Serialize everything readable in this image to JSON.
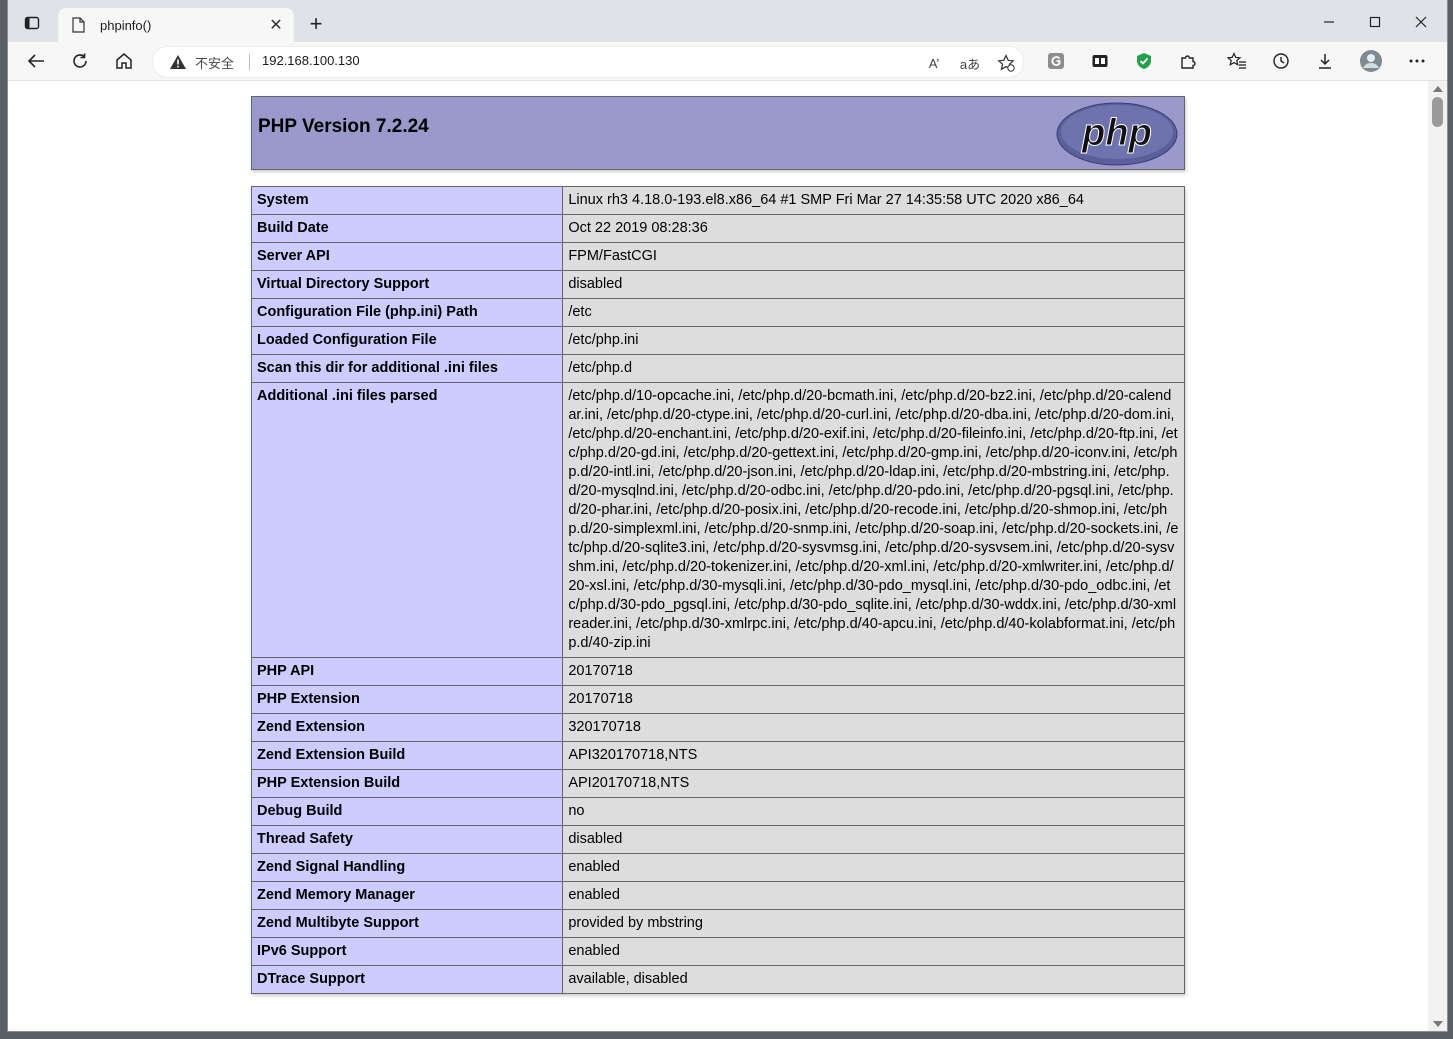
{
  "browser": {
    "tab_title": "phpinfo()",
    "address": {
      "security_label": "不安全",
      "url": "192.168.100.130",
      "read_aloud_label": "A’",
      "translate_label": "aあ"
    }
  },
  "php": {
    "header_title": "PHP Version 7.2.24",
    "logo_text": "php"
  },
  "info_rows": [
    {
      "key": "System",
      "value": "Linux rh3 4.18.0-193.el8.x86_64 #1 SMP Fri Mar 27 14:35:58 UTC 2020 x86_64"
    },
    {
      "key": "Build Date",
      "value": "Oct 22 2019 08:28:36"
    },
    {
      "key": "Server API",
      "value": "FPM/FastCGI"
    },
    {
      "key": "Virtual Directory Support",
      "value": "disabled"
    },
    {
      "key": "Configuration File (php.ini) Path",
      "value": "/etc"
    },
    {
      "key": "Loaded Configuration File",
      "value": "/etc/php.ini"
    },
    {
      "key": "Scan this dir for additional .ini files",
      "value": "/etc/php.d"
    },
    {
      "key": "Additional .ini files parsed",
      "value": "/etc/php.d/10-opcache.ini, /etc/php.d/20-bcmath.ini, /etc/php.d/20-bz2.ini, /etc/php.d/20-calendar.ini, /etc/php.d/20-ctype.ini, /etc/php.d/20-curl.ini, /etc/php.d/20-dba.ini, /etc/php.d/20-dom.ini, /etc/php.d/20-enchant.ini, /etc/php.d/20-exif.ini, /etc/php.d/20-fileinfo.ini, /etc/php.d/20-ftp.ini, /etc/php.d/20-gd.ini, /etc/php.d/20-gettext.ini, /etc/php.d/20-gmp.ini, /etc/php.d/20-iconv.ini, /etc/php.d/20-intl.ini, /etc/php.d/20-json.ini, /etc/php.d/20-ldap.ini, /etc/php.d/20-mbstring.ini, /etc/php.d/20-mysqlnd.ini, /etc/php.d/20-odbc.ini, /etc/php.d/20-pdo.ini, /etc/php.d/20-pgsql.ini, /etc/php.d/20-phar.ini, /etc/php.d/20-posix.ini, /etc/php.d/20-recode.ini, /etc/php.d/20-shmop.ini, /etc/php.d/20-simplexml.ini, /etc/php.d/20-snmp.ini, /etc/php.d/20-soap.ini, /etc/php.d/20-sockets.ini, /etc/php.d/20-sqlite3.ini, /etc/php.d/20-sysvmsg.ini, /etc/php.d/20-sysvsem.ini, /etc/php.d/20-sysvshm.ini, /etc/php.d/20-tokenizer.ini, /etc/php.d/20-xml.ini, /etc/php.d/20-xmlwriter.ini, /etc/php.d/20-xsl.ini, /etc/php.d/30-mysqli.ini, /etc/php.d/30-pdo_mysql.ini, /etc/php.d/30-pdo_odbc.ini, /etc/php.d/30-pdo_pgsql.ini, /etc/php.d/30-pdo_sqlite.ini, /etc/php.d/30-wddx.ini, /etc/php.d/30-xmlreader.ini, /etc/php.d/30-xmlrpc.ini, /etc/php.d/40-apcu.ini, /etc/php.d/40-kolabformat.ini, /etc/php.d/40-zip.ini"
    },
    {
      "key": "PHP API",
      "value": "20170718"
    },
    {
      "key": "PHP Extension",
      "value": "20170718"
    },
    {
      "key": "Zend Extension",
      "value": "320170718"
    },
    {
      "key": "Zend Extension Build",
      "value": "API320170718,NTS"
    },
    {
      "key": "PHP Extension Build",
      "value": "API20170718,NTS"
    },
    {
      "key": "Debug Build",
      "value": "no"
    },
    {
      "key": "Thread Safety",
      "value": "disabled"
    },
    {
      "key": "Zend Signal Handling",
      "value": "enabled"
    },
    {
      "key": "Zend Memory Manager",
      "value": "enabled"
    },
    {
      "key": "Zend Multibyte Support",
      "value": "provided by mbstring"
    },
    {
      "key": "IPv6 Support",
      "value": "enabled"
    },
    {
      "key": "DTrace Support",
      "value": "available, disabled"
    }
  ],
  "colors": {
    "header_bg": "#9999cc",
    "key_bg": "#ccccff",
    "value_bg": "#dddddd",
    "border": "#666666"
  }
}
